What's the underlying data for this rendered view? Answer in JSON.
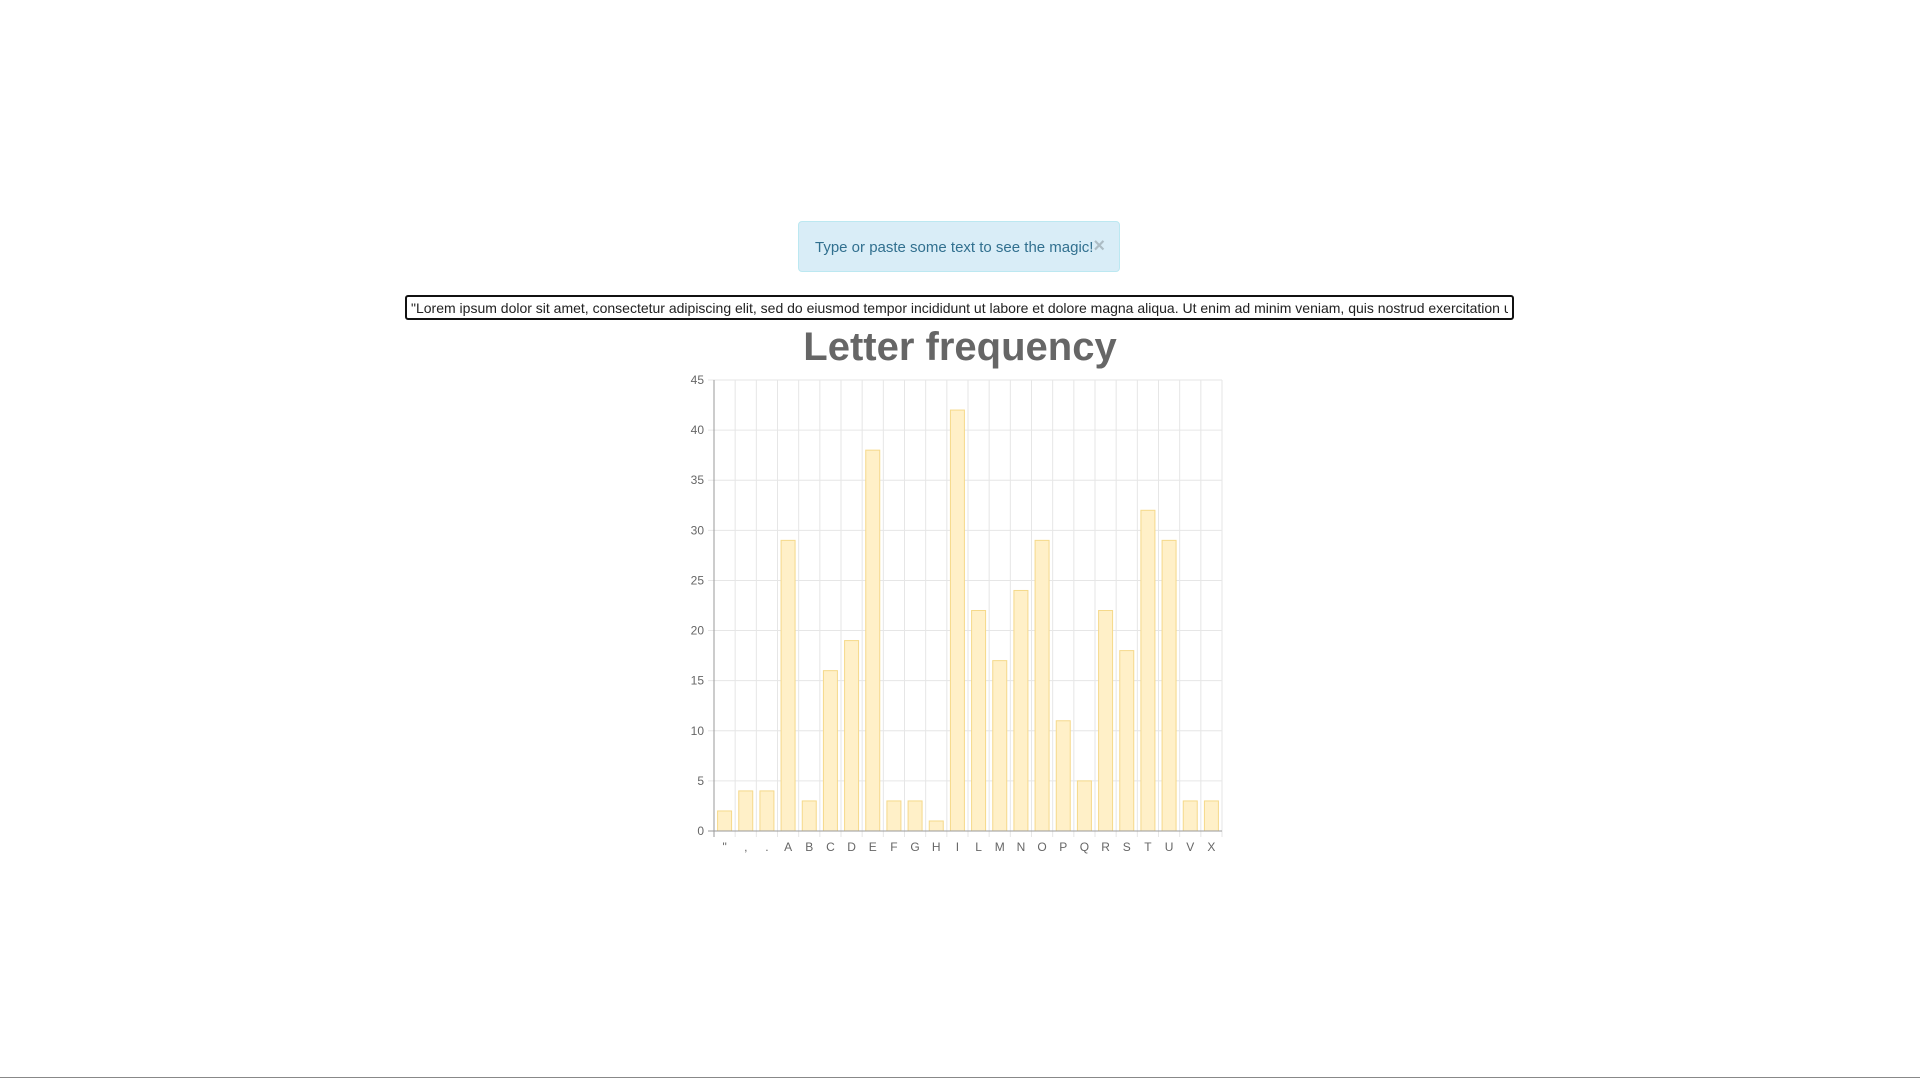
{
  "alert": {
    "message": "Type or paste some text to see the magic!",
    "close_label": "×"
  },
  "text_input": {
    "value": "\"Lorem ipsum dolor sit amet, consectetur adipiscing elit, sed do eiusmod tempor incididunt ut labore et dolore magna aliqua. Ut enim ad minim veniam, quis nostrud exercitation u"
  },
  "chart_data": {
    "type": "bar",
    "title": "Letter frequency",
    "categories": [
      "\"",
      ",",
      ".",
      "A",
      "B",
      "C",
      "D",
      "E",
      "F",
      "G",
      "H",
      "I",
      "L",
      "M",
      "N",
      "O",
      "P",
      "Q",
      "R",
      "S",
      "T",
      "U",
      "V",
      "X"
    ],
    "values": [
      2,
      4,
      4,
      29,
      3,
      16,
      19,
      38,
      3,
      3,
      1,
      42,
      22,
      17,
      24,
      29,
      11,
      5,
      22,
      18,
      32,
      29,
      3,
      3
    ],
    "ylim": [
      0,
      45
    ],
    "yticks": [
      0,
      5,
      10,
      15,
      20,
      25,
      30,
      35,
      40,
      45
    ],
    "xlabel": "",
    "ylabel": "",
    "grid": true,
    "legend": false,
    "bar_fill": "#fff0c8",
    "bar_stroke": "#f5d98a",
    "grid_color": "#e6e6e6",
    "axis_color": "#999999"
  }
}
